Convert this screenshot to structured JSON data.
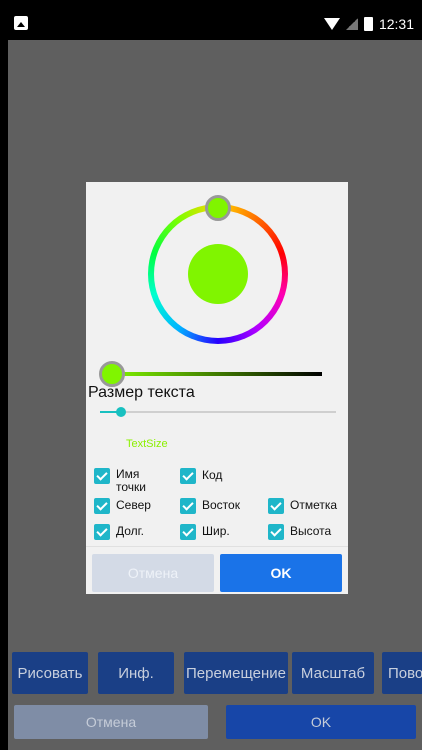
{
  "status_bar": {
    "time": "12:31"
  },
  "background": {
    "toolbar": [
      "Рисовать",
      "Инф.",
      "Перемещение",
      "Масштаб",
      "Пово"
    ],
    "cancel_label": "Отмена",
    "ok_label": "OK"
  },
  "dialog": {
    "selected_color": "#80f500",
    "text_size_title": "Размер текста",
    "text_size_preview": "TextSize",
    "text_size_level": 0.09,
    "checkboxes": [
      {
        "label": "Имя точки",
        "checked": true
      },
      {
        "label": "Код",
        "checked": true
      },
      {
        "label": "Север",
        "checked": true
      },
      {
        "label": "Восток",
        "checked": true
      },
      {
        "label": "Отметка",
        "checked": true
      },
      {
        "label": "Долг.",
        "checked": true
      },
      {
        "label": "Шир.",
        "checked": true
      },
      {
        "label": "Высота",
        "checked": true
      }
    ],
    "cancel_label": "Отмена",
    "ok_label": "OK"
  },
  "colors": {
    "accent": "#1a73e8",
    "checkbox": "#1fb6c9",
    "toolbar": "#1a3f86"
  }
}
